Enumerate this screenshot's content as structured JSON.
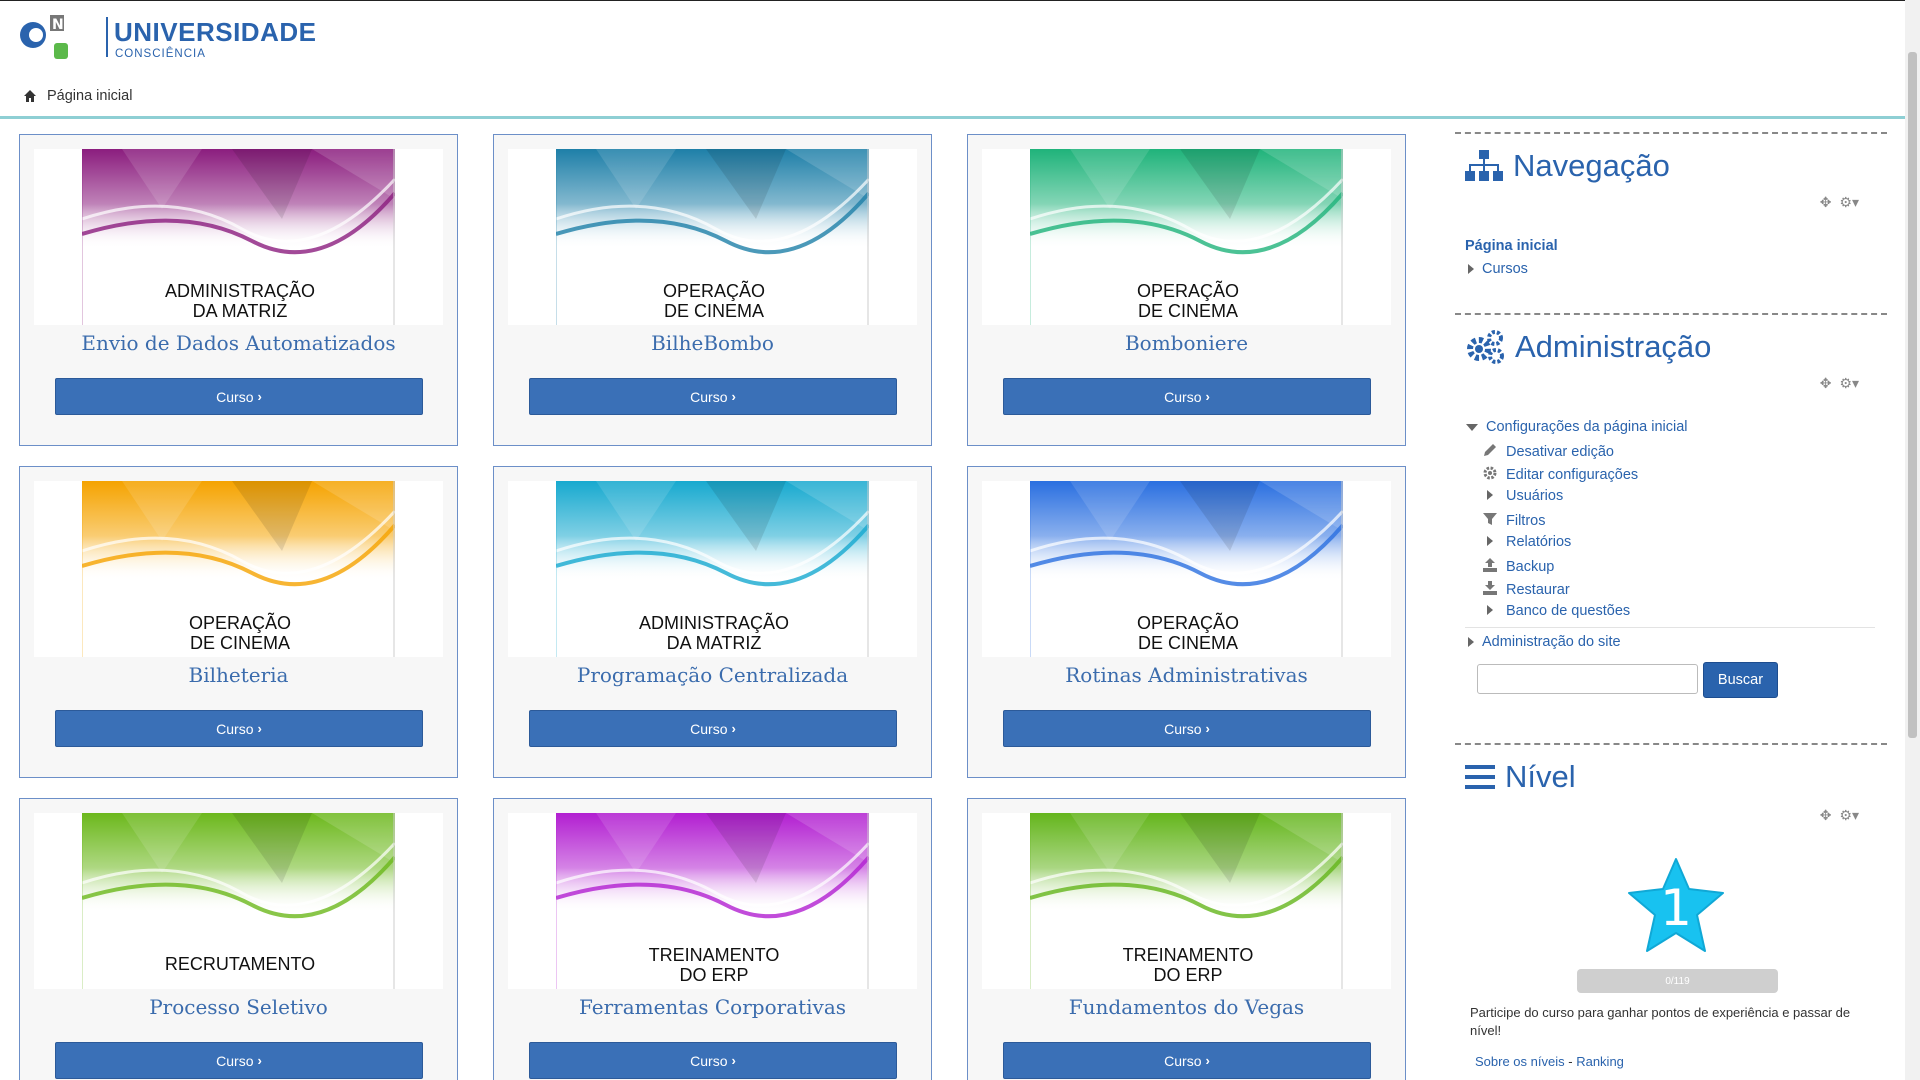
{
  "header": {
    "brand": "UNIVERSIDADE",
    "brand_sub": "CONSCIÊNCIA",
    "breadcrumb": "Página inicial"
  },
  "colors": {
    "accent": "#3a70b7",
    "link": "#2a63ad",
    "header_border": "#8ecfd4"
  },
  "courses": [
    {
      "name": "Envio de Dados Automatizados",
      "image_line1": "ADMINISTRAÇÃO",
      "image_line2": "DA MATRIZ",
      "theme_color": "#8b1d7e",
      "button": "Curso"
    },
    {
      "name": "BilheBombo",
      "image_line1": "OPERAÇÃO",
      "image_line2": "DE CINEMA",
      "theme_color": "#1e7fa8",
      "button": "Curso"
    },
    {
      "name": "Bomboniere",
      "image_line1": "OPERAÇÃO",
      "image_line2": "DE CINEMA",
      "theme_color": "#1fb37a",
      "button": "Curso"
    },
    {
      "name": "Bilheteria",
      "image_line1": "OPERAÇÃO",
      "image_line2": "DE CINEMA",
      "theme_color": "#f5a300",
      "button": "Curso"
    },
    {
      "name": "Programação Centralizada",
      "image_line1": "ADMINISTRAÇÃO",
      "image_line2": "DA MATRIZ",
      "theme_color": "#17a9cf",
      "button": "Curso"
    },
    {
      "name": "Rotinas Administrativas",
      "image_line1": "OPERAÇÃO",
      "image_line2": "DE CINEMA",
      "theme_color": "#2a6fe0",
      "button": "Curso"
    },
    {
      "name": "Processo Seletivo",
      "image_line1": "RECRUTAMENTO",
      "image_line2": "",
      "theme_color": "#6cb81c",
      "button": "Curso"
    },
    {
      "name": "Ferramentas Corporativas",
      "image_line1": "TREINAMENTO",
      "image_line2": "DO ERP",
      "theme_color": "#b21fd1",
      "button": "Curso"
    },
    {
      "name": "Fundamentos do Vegas",
      "image_line1": "TREINAMENTO",
      "image_line2": "DO ERP",
      "theme_color": "#64b51c",
      "button": "Curso"
    }
  ],
  "sidebar": {
    "navigation": {
      "title": "Navegação",
      "home": "Página inicial",
      "courses": "Cursos"
    },
    "admin": {
      "title": "Administração",
      "front_settings": "Configurações da página inicial",
      "items": [
        {
          "label": "Desativar edição",
          "icon": "pencil-icon"
        },
        {
          "label": "Editar configurações",
          "icon": "gear-icon"
        },
        {
          "label": "Usuários",
          "icon": "triangle-right-icon"
        },
        {
          "label": "Filtros",
          "icon": "filter-icon"
        },
        {
          "label": "Relatórios",
          "icon": "triangle-right-icon"
        },
        {
          "label": "Backup",
          "icon": "upload-icon"
        },
        {
          "label": "Restaurar",
          "icon": "download-icon"
        },
        {
          "label": "Banco de questões",
          "icon": "triangle-right-icon"
        }
      ],
      "site_admin": "Administração do site",
      "search_button": "Buscar",
      "search_value": ""
    },
    "level": {
      "title": "Nível",
      "level_number": "1",
      "progress_text": "0/119",
      "progress_fraction": 0,
      "description": "Participe do curso para ganhar pontos de experiência e passar de nível!",
      "link_levels": "Sobre os níveis",
      "separator": "-",
      "link_ranking": "Ranking"
    }
  }
}
